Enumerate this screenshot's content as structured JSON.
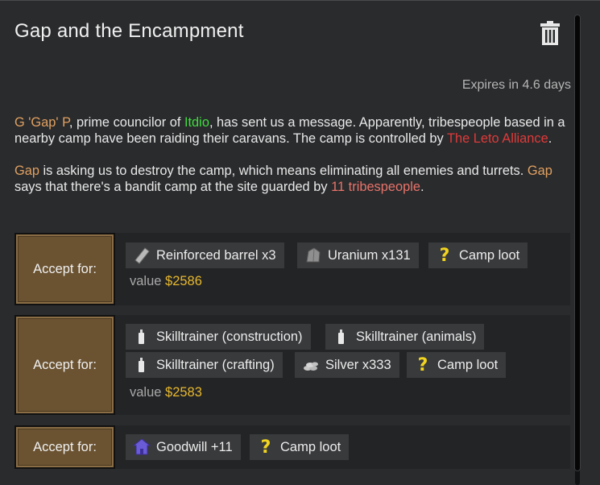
{
  "quest": {
    "title": "Gap and the Encampment",
    "expires": "Expires in 4.6 days"
  },
  "description": {
    "p1": {
      "leader": "G 'Gap' P",
      "t1": ", prime councilor of ",
      "faction": "Itdio",
      "t2": ", has sent us a message. Apparently, tribespeople based in a nearby camp have been raiding their caravans. The camp is controlled by ",
      "enemy": "The Leto Alliance",
      "t3": "."
    },
    "p2": {
      "name1": "Gap",
      "t1": " is asking us to destroy the camp, which means eliminating all enemies and turrets. ",
      "name2": "Gap",
      "t2": " says that there's a bandit camp at the site guarded by ",
      "guards": "11 tribespeople",
      "t3": "."
    }
  },
  "options": [
    {
      "accept_label": "Accept for:",
      "rewards": [
        {
          "label": "Reinforced barrel x3",
          "icon": "barrel-icon"
        },
        {
          "label": "Uranium x131",
          "icon": "uranium-icon"
        },
        {
          "label": "Camp loot",
          "icon": "question-icon"
        }
      ],
      "value_label": "value ",
      "value_amount": "$2586"
    },
    {
      "accept_label": "Accept for:",
      "rewards": [
        {
          "label": "Skilltrainer (construction)",
          "icon": "skilltrainer-icon"
        },
        {
          "label": "Skilltrainer (animals)",
          "icon": "skilltrainer-icon"
        },
        {
          "label": "Skilltrainer (crafting)",
          "icon": "skilltrainer-icon"
        },
        {
          "label": "Silver x333",
          "icon": "silver-icon"
        },
        {
          "label": "Camp loot",
          "icon": "question-icon"
        }
      ],
      "value_label": "value ",
      "value_amount": "$2583"
    },
    {
      "accept_label": "Accept for:",
      "rewards": [
        {
          "label": "Goodwill +11",
          "icon": "goodwill-icon"
        },
        {
          "label": "Camp loot",
          "icon": "question-icon"
        }
      ]
    }
  ],
  "colors": {
    "leader": "#e0a060",
    "faction": "#3fdc3f",
    "enemy": "#e03a3a",
    "guards": "#e8736a",
    "money": "#e6b82e"
  }
}
